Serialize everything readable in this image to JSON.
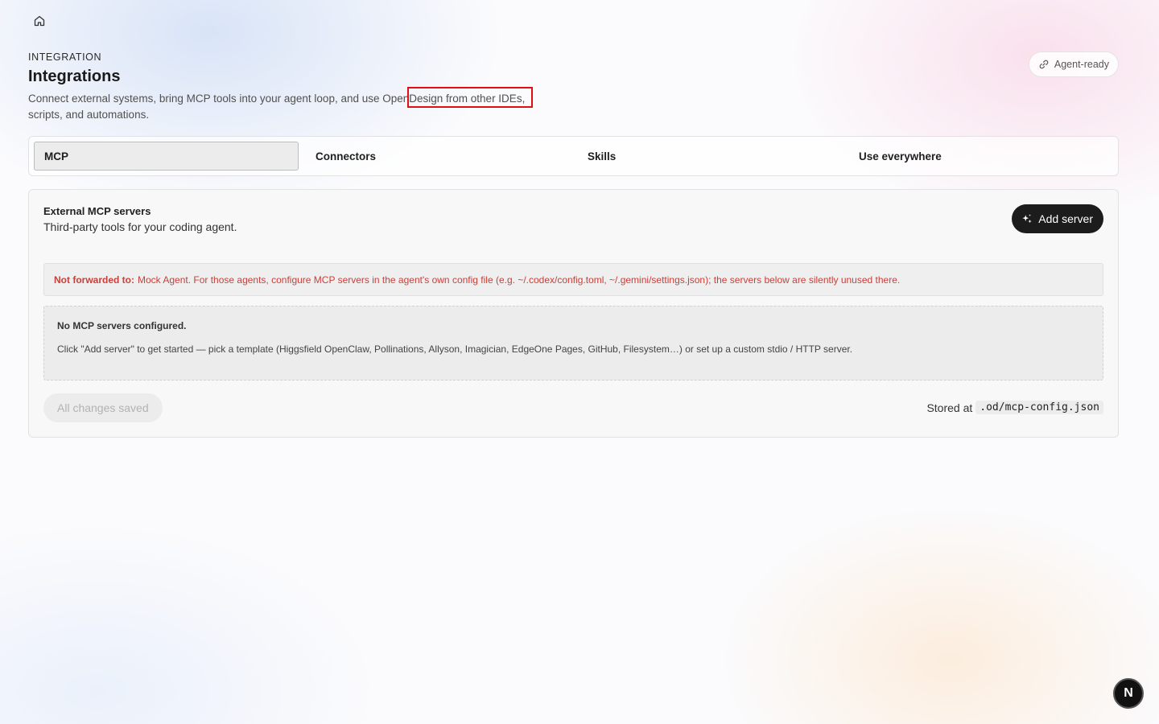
{
  "header": {
    "eyebrow": "INTEGRATION",
    "title": "Integrations",
    "description": "Connect external systems, bring MCP tools into your agent loop, and use OpenDesign from other IDEs, scripts, and automations.",
    "agent_ready_label": "Agent-ready"
  },
  "tabs": [
    {
      "label": "MCP",
      "active": true
    },
    {
      "label": "Connectors",
      "active": false
    },
    {
      "label": "Skills",
      "active": false
    },
    {
      "label": "Use everywhere",
      "active": false
    }
  ],
  "panel": {
    "title": "External MCP servers",
    "subtitle": "Third-party tools for your coding agent.",
    "add_button_label": "Add server",
    "warning": {
      "prefix": "Not forwarded to:",
      "text": "Mock Agent. For those agents, configure MCP servers in the agent's own config file (e.g. ~/.codex/config.toml, ~/.gemini/settings.json); the servers below are silently unused there."
    },
    "empty": {
      "title": "No MCP servers configured.",
      "text": "Click \"Add server\" to get started — pick a template (Higgsfield OpenClaw, Pollinations, Allyson, Imagician, EdgeOne Pages, GitHub, Filesystem…) or set up a custom stdio / HTTP server."
    },
    "save_label": "All changes saved",
    "stored_prefix": "Stored at",
    "stored_path": ".od/mcp-config.json"
  },
  "badge": {
    "letter": "N"
  },
  "colors": {
    "warning_text": "#c8403a",
    "primary_button": "#1c1c1c",
    "highlight_box": "#e01010"
  },
  "icons": {
    "home": "home-icon",
    "agent_ready": "link-icon",
    "add_server": "sparkle-icon"
  }
}
